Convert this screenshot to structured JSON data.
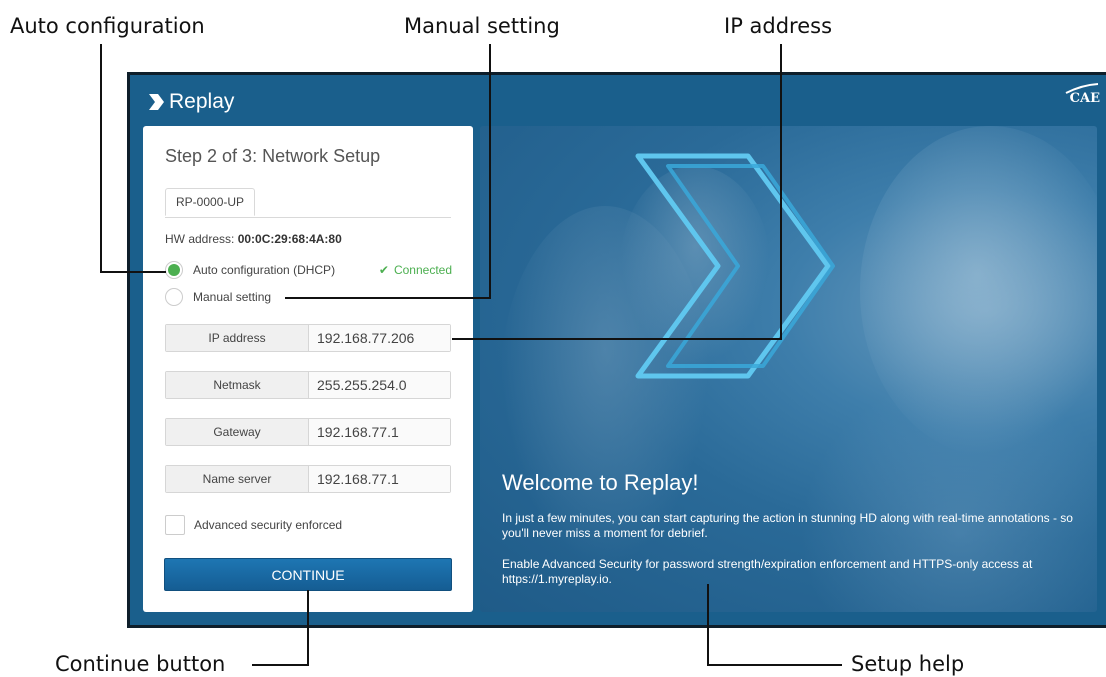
{
  "callouts": {
    "auto_configuration": "Auto configuration",
    "manual_setting": "Manual setting",
    "ip_address": "IP address",
    "continue_button": "Continue button",
    "setup_help": "Setup help"
  },
  "app": {
    "brand": "Replay",
    "partner_logo": "CAE"
  },
  "form": {
    "title": "Step 2 of 3: Network Setup",
    "tab_label": "RP-0000-UP",
    "hw_label": "HW address:",
    "hw_value": "00:0C:29:68:4A:80",
    "auto_config_label": "Auto configuration (DHCP)",
    "auto_config_selected": true,
    "status": "Connected",
    "manual_label": "Manual setting",
    "fields": [
      {
        "label": "IP address",
        "value": "192.168.77.206"
      },
      {
        "label": "Netmask",
        "value": "255.255.254.0"
      },
      {
        "label": "Gateway",
        "value": "192.168.77.1"
      },
      {
        "label": "Name server",
        "value": "192.168.77.1"
      }
    ],
    "advanced_security_label": "Advanced security enforced",
    "advanced_security_checked": false,
    "continue_label": "CONTINUE"
  },
  "hero": {
    "heading": "Welcome to Replay!",
    "paragraph1": "In just a few minutes, you can start capturing the action in stunning HD along with real-time annotations - so you'll never miss a moment for debrief.",
    "paragraph2": "Enable Advanced Security for password strength/expiration enforcement and HTTPS-only access at https://1.myreplay.io."
  },
  "colors": {
    "accent": "#1e76b3",
    "status_green": "#4caf50",
    "frame": "#1a5f8c"
  }
}
